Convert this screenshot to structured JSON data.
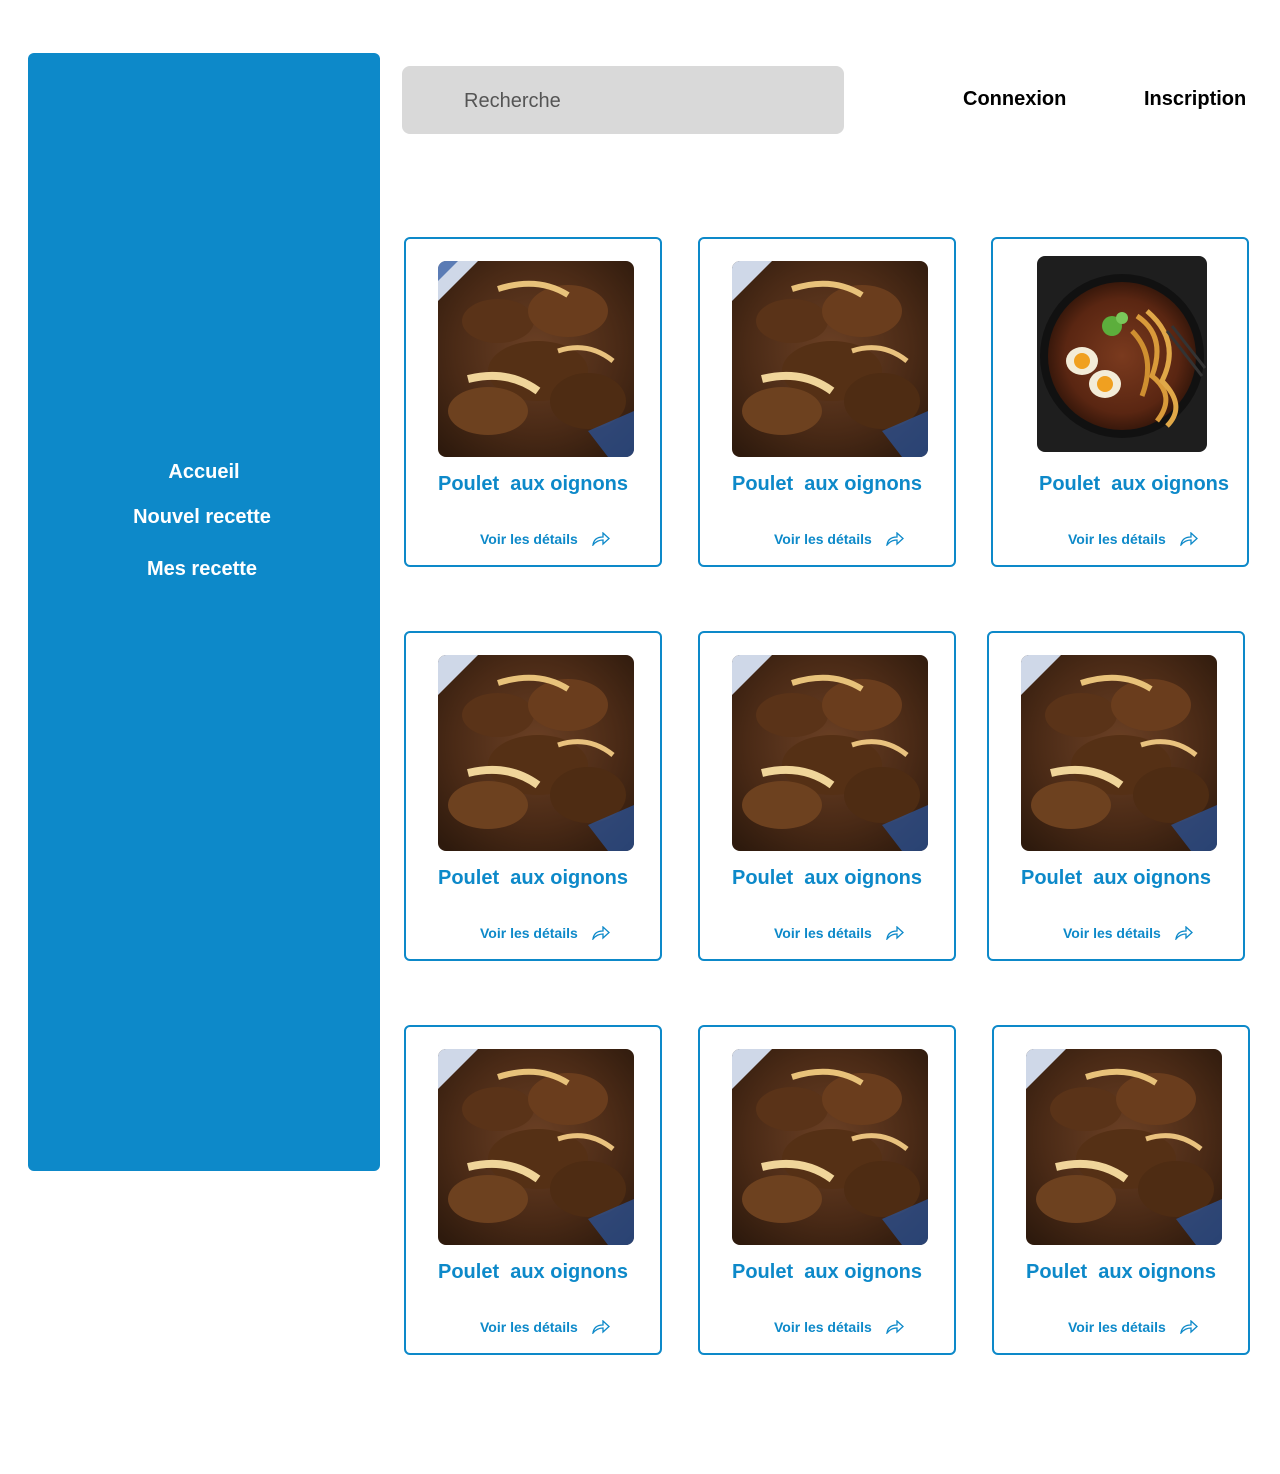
{
  "sidebar": {
    "items": [
      {
        "label": "Accueil"
      },
      {
        "label": "Nouvel recette"
      },
      {
        "label": "Mes recette"
      }
    ]
  },
  "header": {
    "search_placeholder": "Recherche",
    "login_label": "Connexion",
    "signup_label": "Inscription"
  },
  "recipes": [
    {
      "title": "Poulet  aux oignons",
      "details_label": "Voir les détails",
      "image": "beef-onion-dish"
    },
    {
      "title": "Poulet  aux oignons",
      "details_label": "Voir les détails",
      "image": "beef-onion-dish"
    },
    {
      "title": "Poulet  aux oignons",
      "details_label": "Voir les détails",
      "image": "ramen-bowl"
    },
    {
      "title": "Poulet  aux oignons",
      "details_label": "Voir les détails",
      "image": "beef-onion-dish"
    },
    {
      "title": "Poulet  aux oignons",
      "details_label": "Voir les détails",
      "image": "beef-onion-dish"
    },
    {
      "title": "Poulet  aux oignons",
      "details_label": "Voir les détails",
      "image": "beef-onion-dish"
    },
    {
      "title": "Poulet  aux oignons",
      "details_label": "Voir les détails",
      "image": "beef-onion-dish"
    },
    {
      "title": "Poulet  aux oignons",
      "details_label": "Voir les détails",
      "image": "beef-onion-dish"
    },
    {
      "title": "Poulet  aux oignons",
      "details_label": "Voir les détails",
      "image": "beef-onion-dish"
    }
  ],
  "colors": {
    "accent": "#0d89c9",
    "search_bg": "#d9d9d9"
  }
}
